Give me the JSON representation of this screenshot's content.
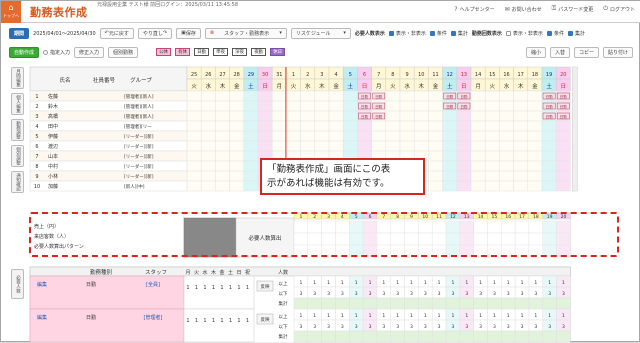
{
  "header": {
    "tab_label": "トップへ",
    "title": "勤務表作成",
    "company": "元禄設用企業 テスト様 前回ログイン：2025/03/11 13:45:58",
    "links": [
      {
        "icon": "help-icon",
        "label": "ヘルプセンター"
      },
      {
        "icon": "mail-icon",
        "label": "お問い合わせ"
      },
      {
        "icon": "key-icon",
        "label": "パスワード変更"
      },
      {
        "icon": "power-icon",
        "label": "ログアウト"
      }
    ]
  },
  "toolbar1": {
    "period_button": "期間",
    "period_value": "2025/04/01～2025/04/30",
    "undo": "元に戻す",
    "redo": "やり直し",
    "save": "保存",
    "staff_select": "スタッフ・勤務表示",
    "risk_select": "リスケジュール",
    "req_label": "必要人数表示",
    "req_opts": [
      "表示・非表示",
      "条件",
      "集計"
    ],
    "shift_label": "勤務回数表示",
    "shift_opts": [
      "表示・非表示",
      "条件",
      "集計"
    ]
  },
  "toolbar2": {
    "auto": "自動作成",
    "fixed": "指定入力",
    "fix_input": "修正入力",
    "clear": "個別勤務",
    "tags": [
      "公休",
      "有休",
      "日勤",
      "準夜",
      "深夜",
      "夜勤",
      "休日"
    ],
    "right_buttons": [
      "縮小",
      "入替",
      "コピー",
      "貼り付け"
    ]
  },
  "side_tabs": [
    "月間編集",
    "個人編集",
    "勤務調整",
    "個別調整",
    "通知確認"
  ],
  "side_tab_lower": "必要人数",
  "staff_table": {
    "headers": [
      "氏名",
      "社員番号",
      "グループ"
    ],
    "rows": [
      {
        "no": "1",
        "name": "佐藤",
        "group": "[管理者][新人]"
      },
      {
        "no": "2",
        "name": "鈴木",
        "group": "[管理者][新人]"
      },
      {
        "no": "3",
        "name": "高橋",
        "group": "[管理者][新人]"
      },
      {
        "no": "4",
        "name": "田中",
        "group": "[管理者][リー"
      },
      {
        "no": "5",
        "name": "伊藤",
        "group": "[リーダー][新]"
      },
      {
        "no": "6",
        "name": "渡辺",
        "group": "[リーダー][新]"
      },
      {
        "no": "7",
        "name": "山本",
        "group": "[リーダー][新]"
      },
      {
        "no": "8",
        "name": "中村",
        "group": "[リーダー][新]"
      },
      {
        "no": "9",
        "name": "小林",
        "group": "[リーダー][新]"
      },
      {
        "no": "10",
        "name": "加藤",
        "group": "[新人][中]"
      }
    ]
  },
  "calendar": {
    "prev_days": [
      "25",
      "26",
      "27",
      "28",
      "29",
      "30",
      "31"
    ],
    "prev_dow": [
      "火",
      "水",
      "木",
      "金",
      "土",
      "日",
      "月"
    ],
    "days": [
      "1",
      "2",
      "3",
      "4",
      "5",
      "6",
      "7",
      "8",
      "9",
      "10",
      "11",
      "12",
      "13",
      "14",
      "15",
      "16",
      "17",
      "18",
      "19",
      "20"
    ],
    "dow": [
      "火",
      "水",
      "木",
      "金",
      "土",
      "日",
      "月",
      "火",
      "水",
      "木",
      "金",
      "土",
      "日",
      "月",
      "火",
      "水",
      "木",
      "金",
      "土",
      "日"
    ],
    "marks": [
      {
        "row": 0,
        "col": 5,
        "label": "日勤"
      },
      {
        "row": 0,
        "col": 6,
        "label": "日勤"
      },
      {
        "row": 0,
        "col": 11,
        "label": "日勤"
      },
      {
        "row": 0,
        "col": 12,
        "label": "日勤"
      },
      {
        "row": 0,
        "col": 18,
        "label": "日勤"
      },
      {
        "row": 0,
        "col": 19,
        "label": "日勤"
      },
      {
        "row": 1,
        "col": 5,
        "label": "日勤"
      },
      {
        "row": 1,
        "col": 6,
        "label": "日勤"
      },
      {
        "row": 1,
        "col": 11,
        "label": "日勤"
      },
      {
        "row": 1,
        "col": 12,
        "label": "日勤"
      },
      {
        "row": 1,
        "col": 18,
        "label": "日勤"
      },
      {
        "row": 1,
        "col": 19,
        "label": "日勤"
      },
      {
        "row": 2,
        "col": 5,
        "label": "日勤"
      },
      {
        "row": 2,
        "col": 6,
        "label": "日勤"
      },
      {
        "row": 2,
        "col": 18,
        "label": "日勤"
      },
      {
        "row": 2,
        "col": 19,
        "label": "日勤"
      }
    ]
  },
  "callout": {
    "line1": "「勤務表作成」画面にこの表",
    "line2": "示があれば機能は有効です。"
  },
  "summary_rows": [
    "売上（円）",
    "来店客数（人）",
    "必要人数算出パターン"
  ],
  "calc_button": "必要人数算出",
  "lower": {
    "headers": [
      "勤務種別",
      "スタッフ",
      "月",
      "火",
      "水",
      "木",
      "金",
      "土",
      "日",
      "祝",
      "人数"
    ],
    "blocks": [
      {
        "edit": "編集",
        "type": "日勤",
        "staff": "[全員]",
        "nums": [
          "1",
          "1",
          "1",
          "1",
          "1",
          "1",
          "1",
          "1"
        ],
        "btn": "反映",
        "rows": [
          "以上",
          "以下",
          "集計"
        ]
      },
      {
        "edit": "編集",
        "type": "日勤",
        "staff": "[管理者]",
        "nums": [
          "1",
          "1",
          "1",
          "1",
          "1",
          "1",
          "1",
          "1"
        ],
        "btn": "反映",
        "rows": [
          "以上",
          "以下",
          "集計"
        ]
      }
    ],
    "row_vals_a": [
      "1",
      "1",
      "1",
      "1"
    ],
    "row_vals_b": [
      "3",
      "3",
      "3",
      "3"
    ]
  }
}
